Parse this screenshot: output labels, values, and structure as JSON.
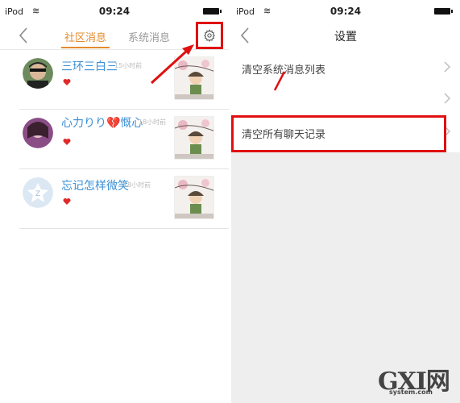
{
  "left": {
    "status": {
      "carrier": "iPod",
      "time": "09:24"
    },
    "tabs": {
      "community": "社区消息",
      "system": "系统消息"
    },
    "messages": [
      {
        "name": "三环三白三",
        "time_ago": "15小时前"
      },
      {
        "name": "心力りり💔慨心",
        "time_ago": "18小时前"
      },
      {
        "name": "忘记怎样微笑",
        "time_ago": "18小时前"
      }
    ]
  },
  "right": {
    "status": {
      "carrier": "iPod",
      "time": "09:24"
    },
    "title": "设置",
    "rows": [
      {
        "label": "清空系统消息列表"
      },
      {
        "label": ""
      },
      {
        "label": "清空所有聊天记录"
      }
    ]
  },
  "watermark": {
    "brand": "GXI网",
    "domain": "system.com"
  },
  "icons": {
    "back": "chevron-left-icon",
    "settings": "gear-icon",
    "like": "heart-icon",
    "row_arrow": "chevron-right-icon"
  },
  "colors": {
    "accent_orange": "#e58a2e",
    "name_blue": "#3a8fd6",
    "highlight_red": "#e01010",
    "heart_red": "#e02a2a"
  }
}
